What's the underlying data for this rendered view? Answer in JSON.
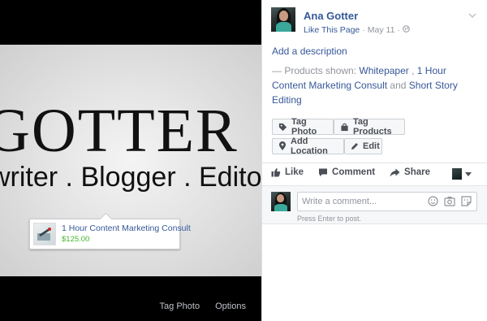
{
  "viewer": {
    "brand_title": "GOTTER",
    "brand_subtitle": "writer . Blogger . Editor",
    "product_tag": {
      "name": "1 Hour Content Marketing Consult",
      "price": "$125.00"
    },
    "footer": {
      "tag_photo": "Tag Photo",
      "options": "Options"
    }
  },
  "post": {
    "author": "Ana Gotter",
    "like_page": "Like This Page",
    "separator": "·",
    "date": "May 11",
    "separator2": "·",
    "add_description": "Add a description",
    "products_prefix": "— Products shown:",
    "product_1": "Whitepaper",
    "comma": ",",
    "product_2": "1 Hour Content Marketing Consult",
    "and": "and",
    "product_3": "Short Story Editing"
  },
  "buttons": {
    "tag_photo": "Tag Photo",
    "tag_products": "Tag Products",
    "add_location": "Add Location",
    "edit": "Edit"
  },
  "actions": {
    "like": "Like",
    "comment": "Comment",
    "share": "Share"
  },
  "comment": {
    "placeholder": "Write a comment...",
    "hint": "Press Enter to post."
  },
  "colors": {
    "link": "#365899",
    "price": "#42b72a",
    "muted": "#90949c",
    "button_text": "#4b4f56"
  }
}
